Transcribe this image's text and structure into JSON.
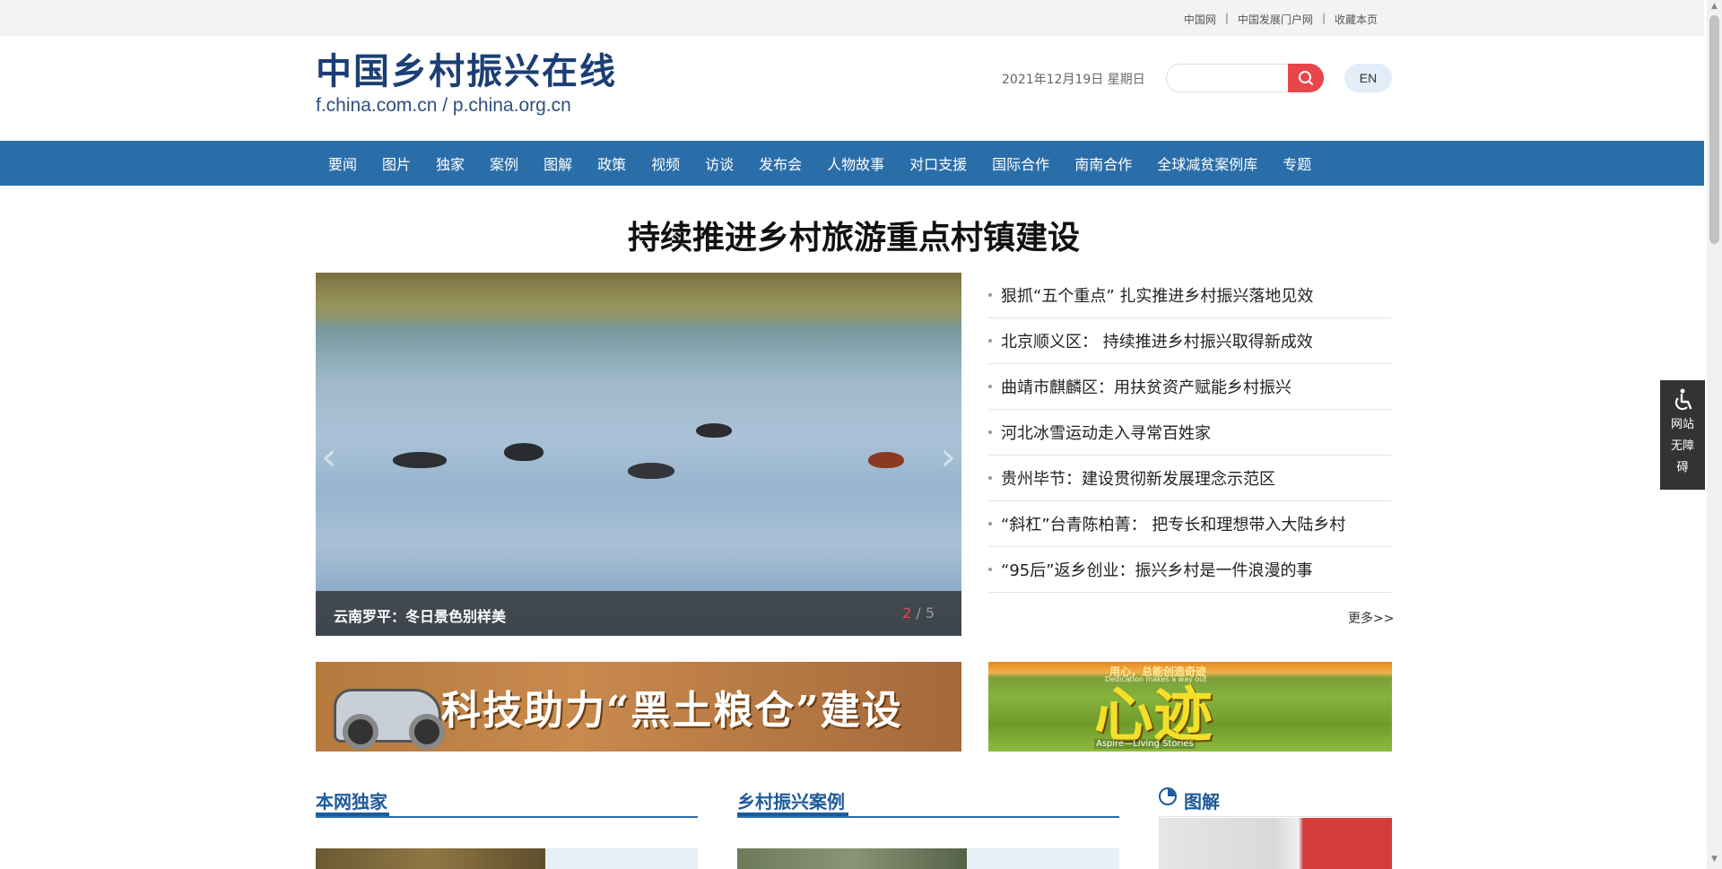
{
  "toplinks": [
    "中国网",
    "中国发展门户网",
    "收藏本页"
  ],
  "toplinks_sep": "|",
  "header": {
    "logo_cn": "中国乡村振兴在线",
    "logo_url": "f.china.com.cn  /  p.china.org.cn",
    "date": "2021年12月19日  星期日",
    "search_placeholder": "",
    "en_label": "EN"
  },
  "nav": [
    "要闻",
    "图片",
    "独家",
    "案例",
    "图解",
    "政策",
    "视频",
    "访谈",
    "发布会",
    "人物故事",
    "对口支援",
    "国际合作",
    "南南合作",
    "全球减贫案例库",
    "专题"
  ],
  "headline": "持续推进乡村旅游重点村镇建设",
  "slider": {
    "caption": "云南罗平：冬日景色别样美",
    "current": "2",
    "separator": " / ",
    "total": "5"
  },
  "news": [
    "狠抓“五个重点” 扎实推进乡村振兴落地见效",
    "北京顺义区： 持续推进乡村振兴取得新成效",
    "曲靖市麒麟区：用扶贫资产赋能乡村振兴",
    "河北冰雪运动走入寻常百姓家",
    "贵州毕节：建设贯彻新发展理念示范区",
    "“斜杠”台青陈柏菁： 把专长和理想带入大陆乡村",
    "“95后”返乡创业：振兴乡村是一件浪漫的事"
  ],
  "more_label": "更多>>",
  "banners": {
    "banner1_text": "科技助力“黑土粮仓”建设",
    "banner2_small1": "用心，总能创造奇迹",
    "banner2_small2": "Dedication makes a way out",
    "banner2_big": "心迹",
    "banner2_small3": "Aspire—Living Stories"
  },
  "sections": {
    "exclusive": "本网独家",
    "cases": "乡村振兴案例",
    "graphics": "图解"
  },
  "accessibility": {
    "line1": "网站",
    "line2": "无障",
    "line3": "碍"
  },
  "colors": {
    "nav_bg": "#2a6ea9",
    "accent_red": "#e8464a",
    "logo_blue": "#1b3f74"
  }
}
